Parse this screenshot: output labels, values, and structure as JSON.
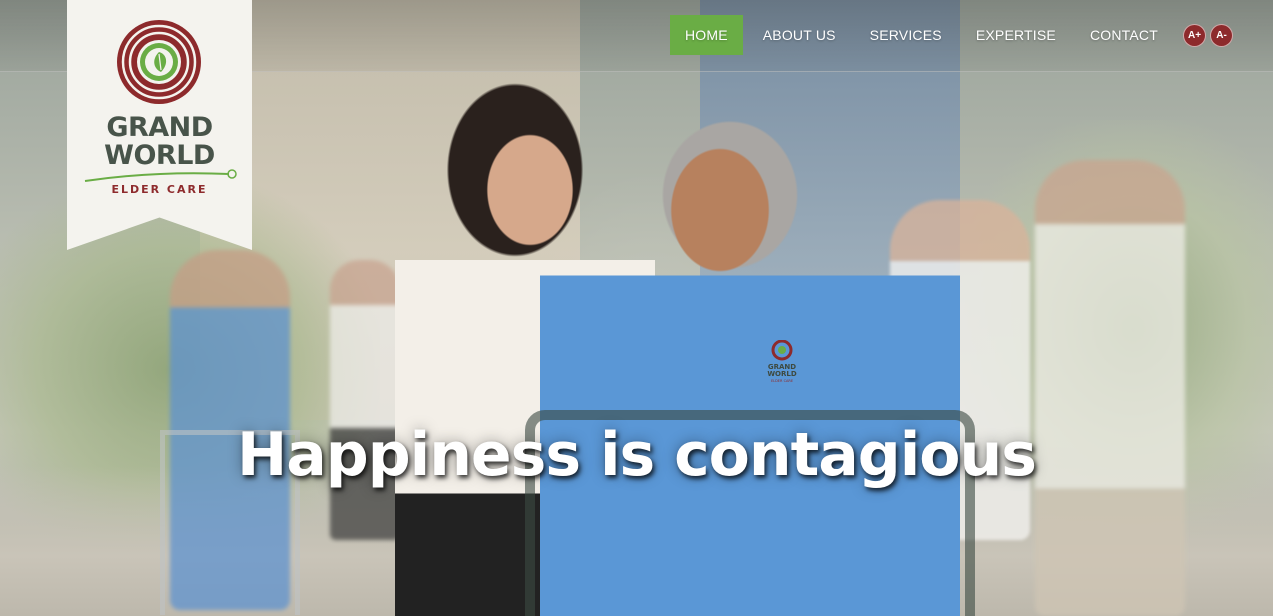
{
  "brand": {
    "name_line1": "GRAND",
    "name_line2": "WORLD",
    "tagline": "ELDER CARE",
    "colors": {
      "green": "#6aad45",
      "maroon": "#8d2a2c",
      "slate": "#48544a"
    }
  },
  "nav": {
    "items": [
      {
        "label": "HOME",
        "active": true
      },
      {
        "label": "ABOUT US",
        "active": false
      },
      {
        "label": "SERVICES",
        "active": false
      },
      {
        "label": "EXPERTISE",
        "active": false
      },
      {
        "label": "CONTACT",
        "active": false
      }
    ],
    "font_increase": "A+",
    "font_decrease": "A-"
  },
  "hero": {
    "headline": "Happiness is contagious",
    "icons": [
      "tree-ring-leaf-logo"
    ]
  },
  "shirt_logo": {
    "line1": "GRAND",
    "line2": "WORLD",
    "line3": "ELDER CARE"
  }
}
